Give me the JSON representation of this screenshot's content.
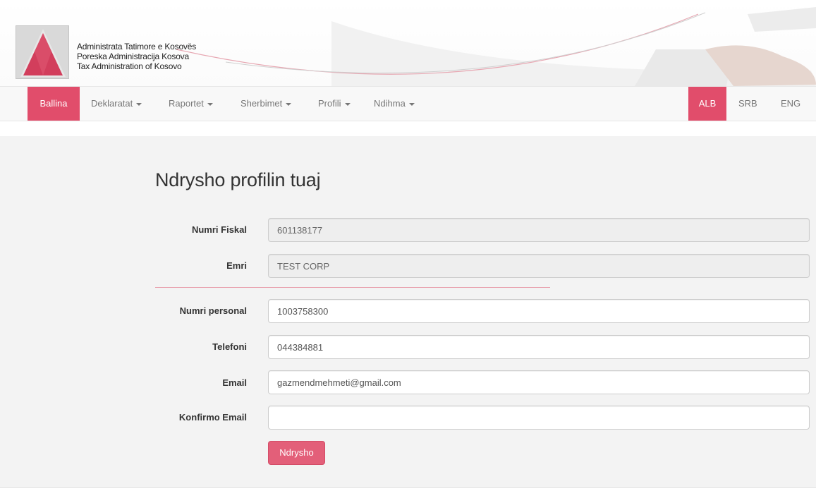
{
  "header": {
    "org_names": [
      "Administrata Tatimore e Kosovës",
      "Poreska Administracija Kosova",
      "Tax Administration of Kosovo"
    ],
    "logo_icon": "red-triangle-logo-icon",
    "brand_color": "#e14d6b"
  },
  "nav": {
    "items": [
      {
        "label": "Ballina",
        "active": true,
        "dropdown": false
      },
      {
        "label": "Deklaratat",
        "active": false,
        "dropdown": true
      },
      {
        "label": "Raportet",
        "active": false,
        "dropdown": true
      },
      {
        "label": "Sherbimet",
        "active": false,
        "dropdown": true
      },
      {
        "label": "Profili",
        "active": false,
        "dropdown": true
      },
      {
        "label": "Ndihma",
        "active": false,
        "dropdown": true
      }
    ],
    "languages": [
      {
        "label": "ALB",
        "active": true
      },
      {
        "label": "SRB",
        "active": false
      },
      {
        "label": "ENG",
        "active": false
      }
    ]
  },
  "form": {
    "title": "Ndrysho profilin tuaj",
    "fiscal_number": {
      "label": "Numri Fiskal",
      "value": "601138177"
    },
    "name": {
      "label": "Emri",
      "value": "TEST CORP"
    },
    "personal_number": {
      "label": "Numri personal",
      "value": "1003758300"
    },
    "phone": {
      "label": "Telefoni",
      "value": "044384881"
    },
    "email": {
      "label": "Email",
      "value": "gazmendmehmeti@gmail.com"
    },
    "confirm_email": {
      "label": "Konfirmo Email",
      "value": ""
    },
    "submit_label": "Ndrysho"
  }
}
